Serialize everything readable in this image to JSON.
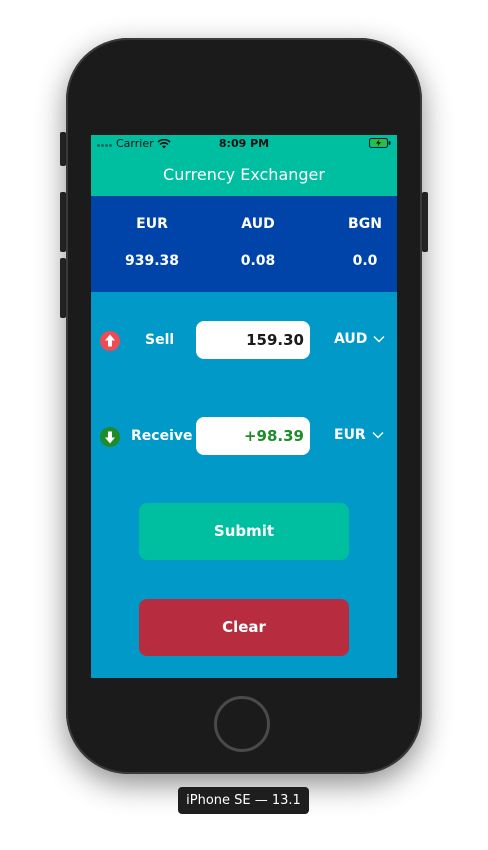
{
  "status_bar": {
    "carrier": "Carrier",
    "time": "8:09 PM"
  },
  "app": {
    "title": "Currency Exchanger"
  },
  "rates": [
    {
      "code": "EUR",
      "value": "939.38"
    },
    {
      "code": "AUD",
      "value": "0.08"
    },
    {
      "code": "BGN",
      "value": "0.0"
    }
  ],
  "sell": {
    "label": "Sell",
    "amount": "159.30",
    "currency": "AUD",
    "icon": "arrow-up-icon",
    "icon_color": "#ef4b55"
  },
  "receive": {
    "label": "Receive",
    "amount": "+98.39",
    "currency": "EUR",
    "icon": "arrow-down-icon",
    "icon_color": "#1e8c2a"
  },
  "buttons": {
    "submit": "Submit",
    "clear": "Clear"
  },
  "device": {
    "label": "iPhone SE — 13.1"
  },
  "colors": {
    "header": "#00bfa0",
    "rates_panel": "#0044aa",
    "background": "#0099c8",
    "submit": "#00bfa0",
    "clear": "#b82c40"
  }
}
